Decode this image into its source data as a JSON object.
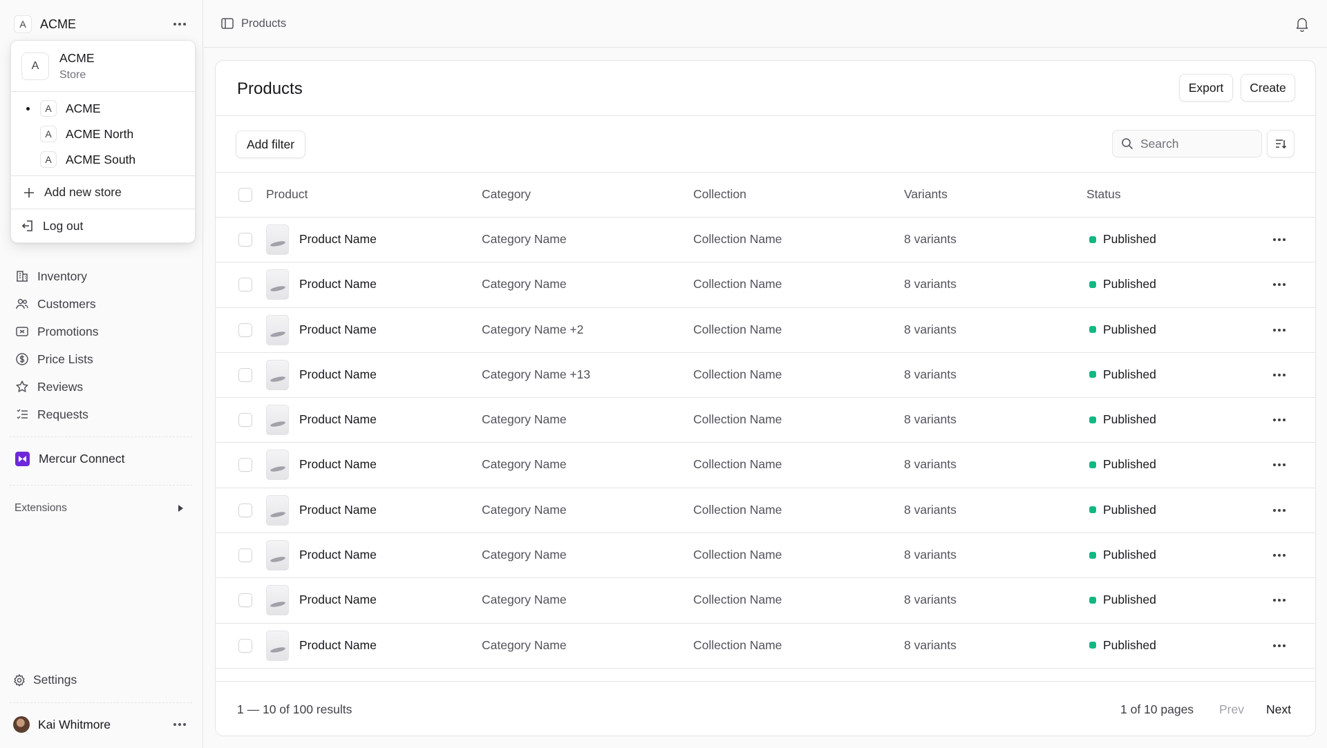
{
  "sidebar": {
    "store_initial": "A",
    "store_name": "ACME",
    "nav": [
      {
        "label": "Inventory",
        "icon": "building-icon"
      },
      {
        "label": "Customers",
        "icon": "users-icon"
      },
      {
        "label": "Promotions",
        "icon": "ticket-icon"
      },
      {
        "label": "Price Lists",
        "icon": "dollar-icon"
      },
      {
        "label": "Reviews",
        "icon": "star-icon"
      },
      {
        "label": "Requests",
        "icon": "list-icon"
      }
    ],
    "mercur": "Mercur Connect",
    "extensions": "Extensions",
    "settings": "Settings",
    "user_name": "Kai Whitmore"
  },
  "dropdown": {
    "initial": "A",
    "title": "ACME",
    "subtitle": "Store",
    "stores": [
      {
        "initial": "A",
        "name": "ACME",
        "active": true
      },
      {
        "initial": "A",
        "name": "ACME North",
        "active": false
      },
      {
        "initial": "A",
        "name": "ACME South",
        "active": false
      }
    ],
    "add_store": "Add new store",
    "logout": "Log out"
  },
  "topbar": {
    "breadcrumb": "Products"
  },
  "products": {
    "title": "Products",
    "export_label": "Export",
    "create_label": "Create",
    "add_filter_label": "Add filter",
    "search_placeholder": "Search",
    "columns": {
      "product": "Product",
      "category": "Category",
      "collection": "Collection",
      "variants": "Variants",
      "status": "Status"
    },
    "rows": [
      {
        "product": "Product Name",
        "category": "Category Name",
        "collection": "Collection Name",
        "variants": "8 variants",
        "status": "Published"
      },
      {
        "product": "Product Name",
        "category": "Category Name",
        "collection": "Collection Name",
        "variants": "8 variants",
        "status": "Published"
      },
      {
        "product": "Product Name",
        "category": "Category Name +2",
        "collection": "Collection Name",
        "variants": "8 variants",
        "status": "Published"
      },
      {
        "product": "Product Name",
        "category": "Category Name +13",
        "collection": "Collection Name",
        "variants": "8 variants",
        "status": "Published"
      },
      {
        "product": "Product Name",
        "category": "Category Name",
        "collection": "Collection Name",
        "variants": "8 variants",
        "status": "Published"
      },
      {
        "product": "Product Name",
        "category": "Category Name",
        "collection": "Collection Name",
        "variants": "8 variants",
        "status": "Published"
      },
      {
        "product": "Product Name",
        "category": "Category Name",
        "collection": "Collection Name",
        "variants": "8 variants",
        "status": "Published"
      },
      {
        "product": "Product Name",
        "category": "Category Name",
        "collection": "Collection Name",
        "variants": "8 variants",
        "status": "Published"
      },
      {
        "product": "Product Name",
        "category": "Category Name",
        "collection": "Collection Name",
        "variants": "8 variants",
        "status": "Published"
      },
      {
        "product": "Product Name",
        "category": "Category Name",
        "collection": "Collection Name",
        "variants": "8 variants",
        "status": "Published"
      }
    ],
    "results_text": "1 — 10 of 100 results",
    "pages_text": "1 of 10 pages",
    "prev_label": "Prev",
    "next_label": "Next"
  },
  "colors": {
    "accent_status": "#10b981",
    "mercur_brand": "#6d28d9"
  }
}
